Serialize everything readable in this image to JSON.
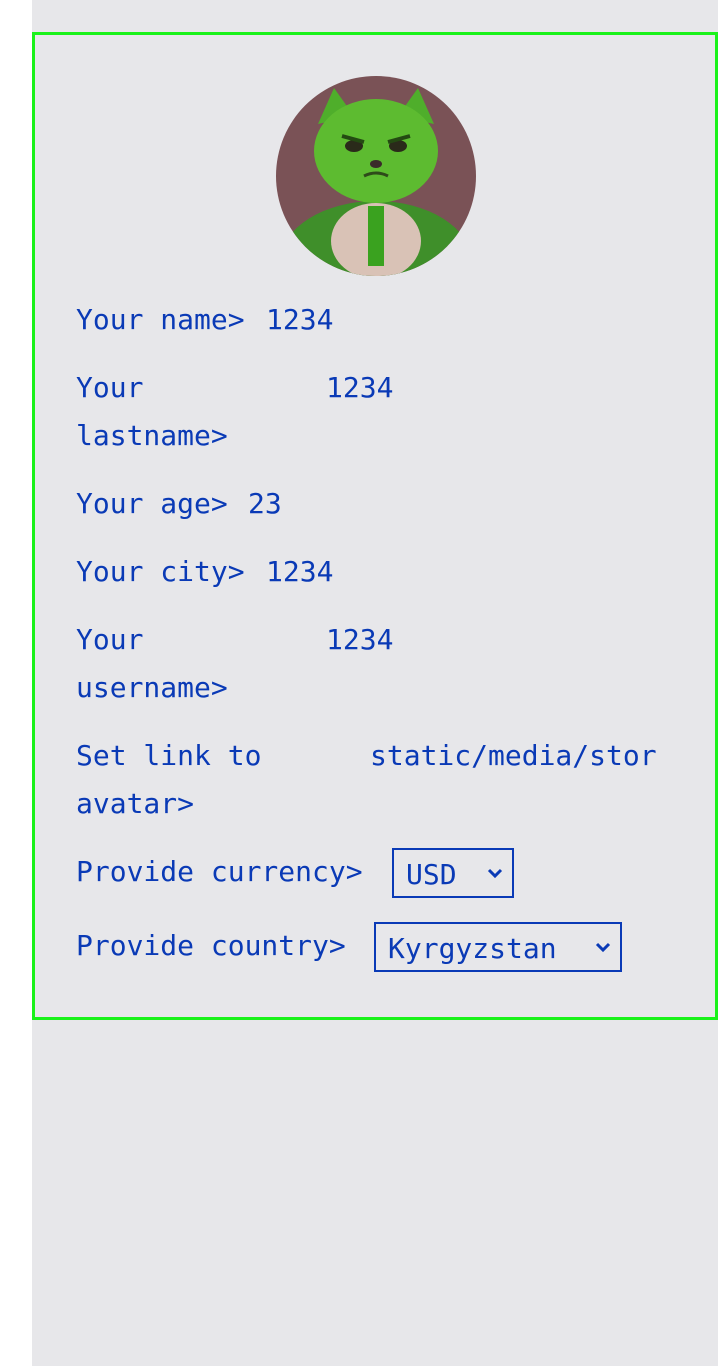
{
  "profile": {
    "avatar_icon": "green-cat-avatar",
    "fields": [
      {
        "label": "Your name>",
        "value": "1234"
      },
      {
        "label_line1": "Your",
        "label_line2": "lastname>",
        "value": "1234"
      },
      {
        "label": "Your age>",
        "value": "23"
      },
      {
        "label": "Your city>",
        "value": "1234"
      },
      {
        "label_line1": "Your",
        "label_line2": "username>",
        "value": "1234"
      },
      {
        "label_line1": "Set link to",
        "label_line2": "avatar>",
        "value": "static/media/stor"
      }
    ],
    "currency": {
      "label": "Provide currency>",
      "selected": "USD"
    },
    "country": {
      "label": "Provide country>",
      "selected": "Kyrgyzstan"
    }
  },
  "colors": {
    "text": "#0a3ab6",
    "panel_border": "#1af21a",
    "background": "#e7e7ea"
  }
}
